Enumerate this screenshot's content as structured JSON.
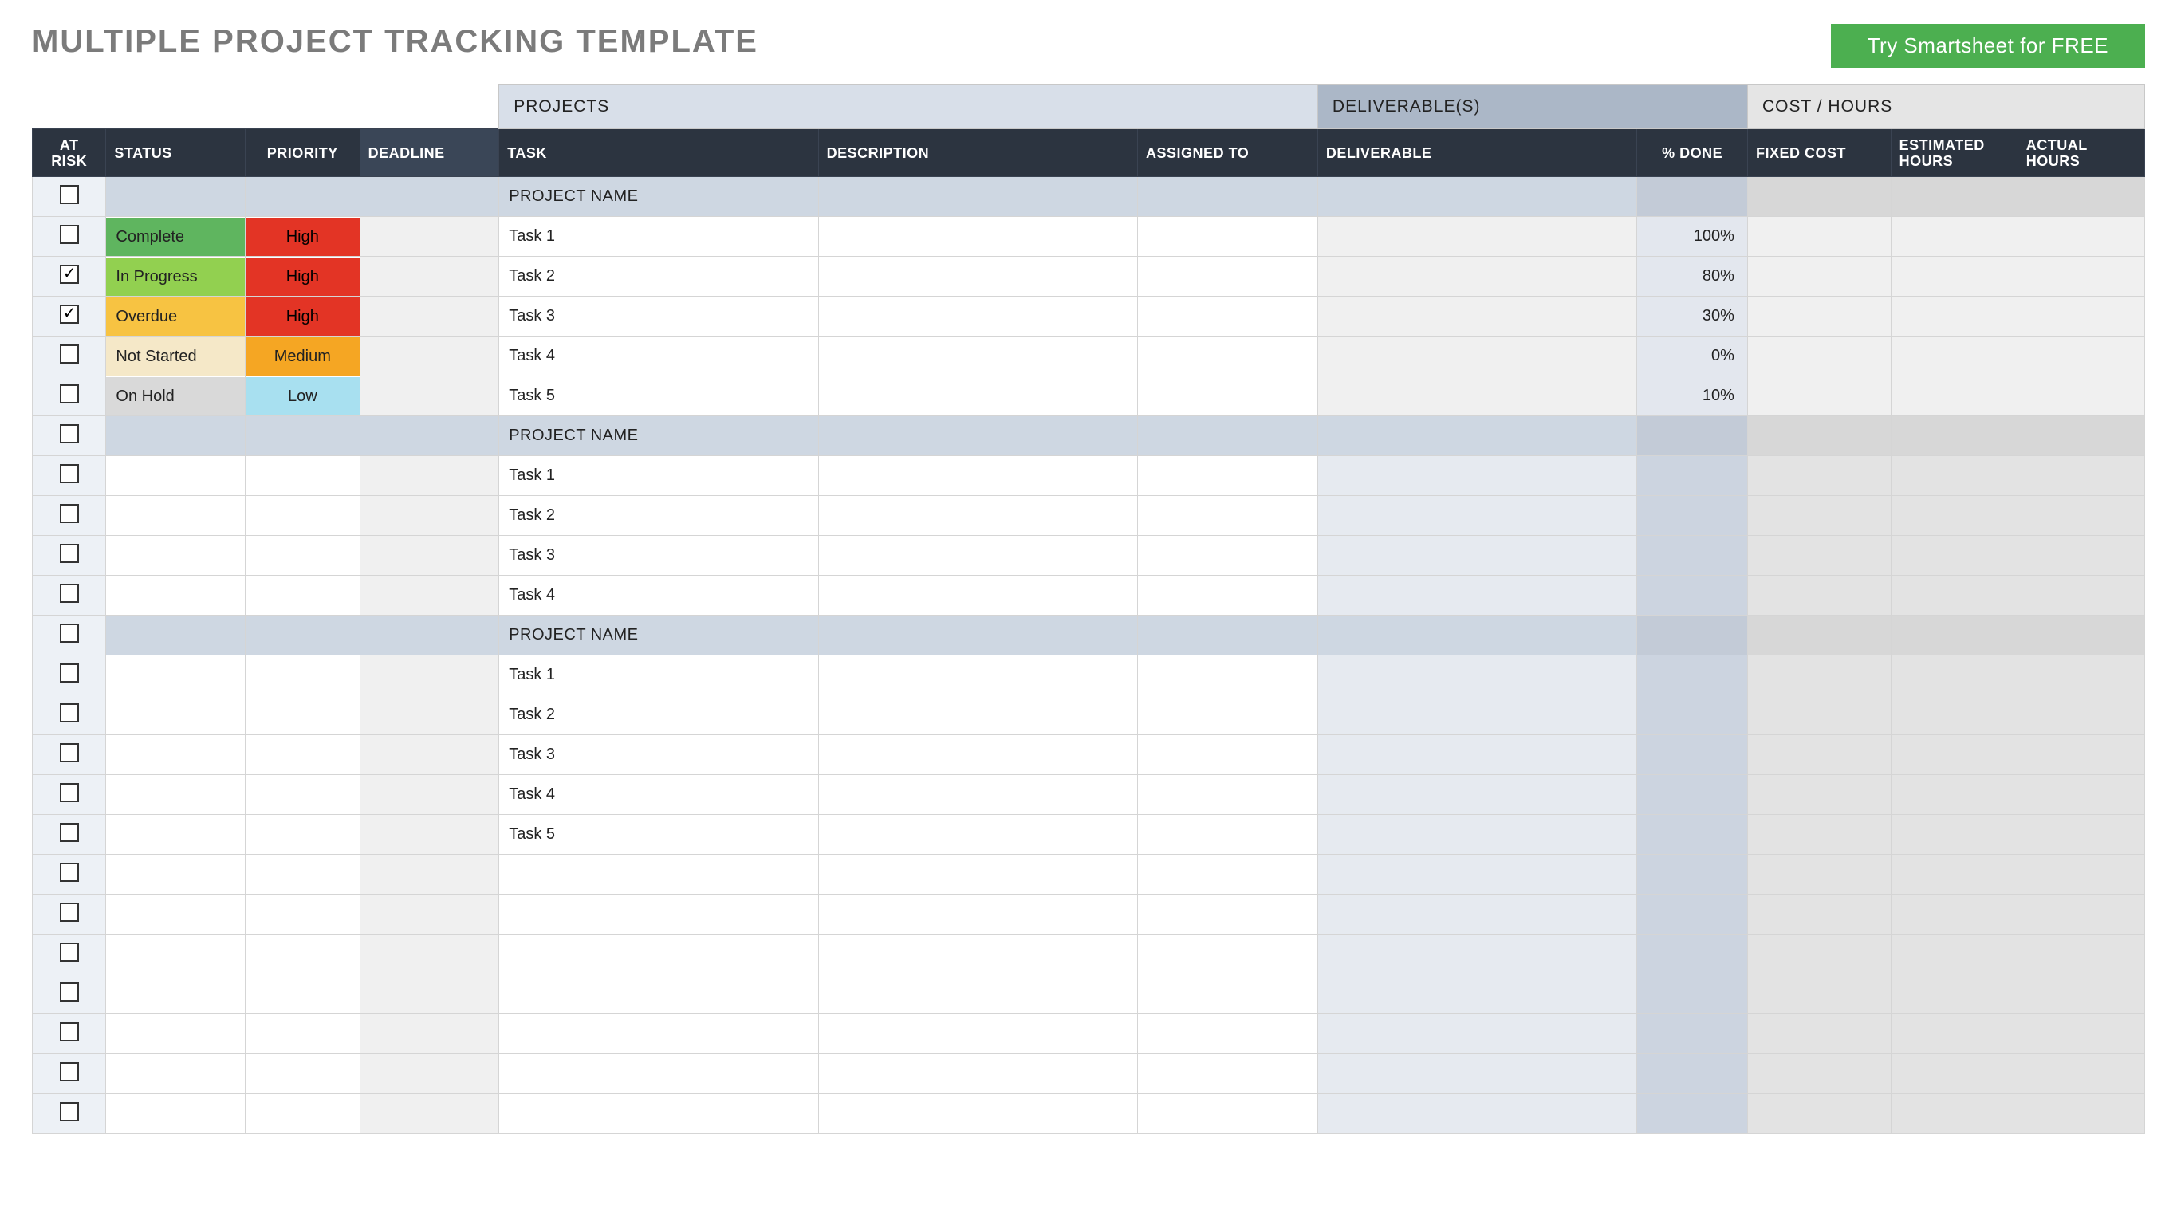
{
  "title": "MULTIPLE PROJECT TRACKING TEMPLATE",
  "cta": "Try Smartsheet for FREE",
  "categories": {
    "projects": "PROJECTS",
    "deliverables": "DELIVERABLE(S)",
    "cost": "COST / HOURS"
  },
  "columns": {
    "risk": "AT RISK",
    "status": "STATUS",
    "priority": "PRIORITY",
    "deadline": "DEADLINE",
    "task": "TASK",
    "desc": "DESCRIPTION",
    "assigned": "ASSIGNED TO",
    "deliverable": "DELIVERABLE",
    "pct": "% DONE",
    "fixed": "FIXED COST",
    "est": "ESTIMATED HOURS",
    "act": "ACTUAL HOURS"
  },
  "status_labels": {
    "complete": "Complete",
    "inprogress": "In Progress",
    "overdue": "Overdue",
    "notstarted": "Not Started",
    "onhold": "On Hold"
  },
  "priority_labels": {
    "high": "High",
    "medium": "Medium",
    "low": "Low"
  },
  "rows": [
    {
      "type": "pname",
      "task": "PROJECT NAME"
    },
    {
      "type": "task",
      "checked": false,
      "status": "complete",
      "prio": "high",
      "task": "Task 1",
      "pct": "100%"
    },
    {
      "type": "task",
      "checked": true,
      "status": "inprogress",
      "prio": "high",
      "task": "Task 2",
      "pct": "80%"
    },
    {
      "type": "task",
      "checked": true,
      "status": "overdue",
      "prio": "high",
      "task": "Task 3",
      "pct": "30%"
    },
    {
      "type": "task",
      "checked": false,
      "status": "notstarted",
      "prio": "medium",
      "task": "Task 4",
      "pct": "0%"
    },
    {
      "type": "task",
      "checked": false,
      "status": "onhold",
      "prio": "low",
      "task": "Task 5",
      "pct": "10%"
    },
    {
      "type": "pname",
      "task": "PROJECT NAME"
    },
    {
      "type": "task2",
      "task": "Task 1"
    },
    {
      "type": "task2",
      "task": "Task 2"
    },
    {
      "type": "task2",
      "task": "Task 3"
    },
    {
      "type": "task2",
      "task": "Task 4"
    },
    {
      "type": "pname",
      "task": "PROJECT NAME"
    },
    {
      "type": "task2",
      "task": "Task 1"
    },
    {
      "type": "task2",
      "task": "Task 2"
    },
    {
      "type": "task2",
      "task": "Task 3"
    },
    {
      "type": "task2",
      "task": "Task 4"
    },
    {
      "type": "task2",
      "task": "Task 5"
    },
    {
      "type": "task2"
    },
    {
      "type": "task2"
    },
    {
      "type": "task2"
    },
    {
      "type": "task2"
    },
    {
      "type": "task2"
    },
    {
      "type": "task2"
    },
    {
      "type": "task2"
    }
  ]
}
